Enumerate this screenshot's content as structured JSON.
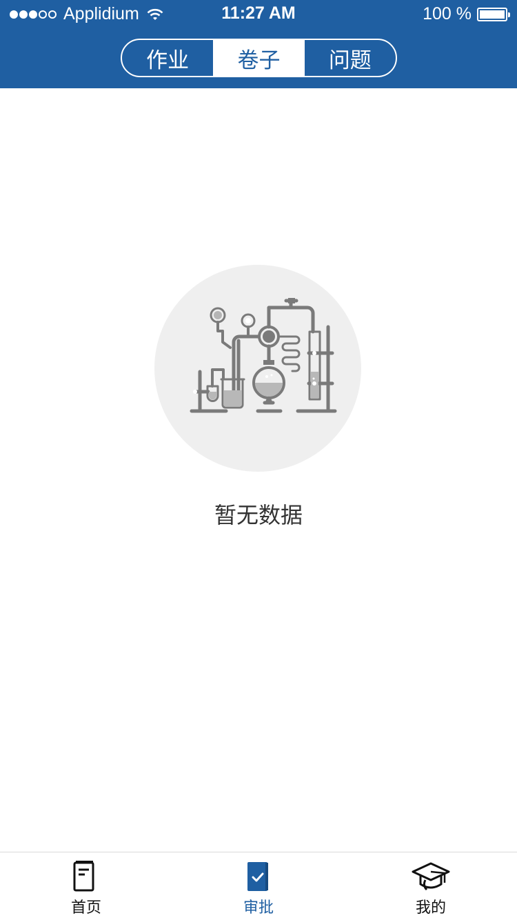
{
  "status_bar": {
    "carrier": "Applidium",
    "time": "11:27 AM",
    "battery": "100 %",
    "signal_filled": 3,
    "signal_total": 5,
    "battery_level": 1.0
  },
  "segments": [
    {
      "label": "作业",
      "selected": false
    },
    {
      "label": "卷子",
      "selected": true
    },
    {
      "label": "问题",
      "selected": false
    }
  ],
  "empty_state": {
    "icon": "lab-equipment-illustration",
    "text": "暂无数据"
  },
  "tabs": [
    {
      "label": "首页",
      "icon": "book-icon",
      "selected": false
    },
    {
      "label": "审批",
      "icon": "approval-book-check-icon",
      "selected": true
    },
    {
      "label": "我的",
      "icon": "graduation-cap-icon",
      "selected": false
    }
  ],
  "colors": {
    "primary": "#1f5fa2",
    "background": "#ffffff",
    "empty_circle": "#efefef",
    "illustration": "#7a7a7a"
  }
}
